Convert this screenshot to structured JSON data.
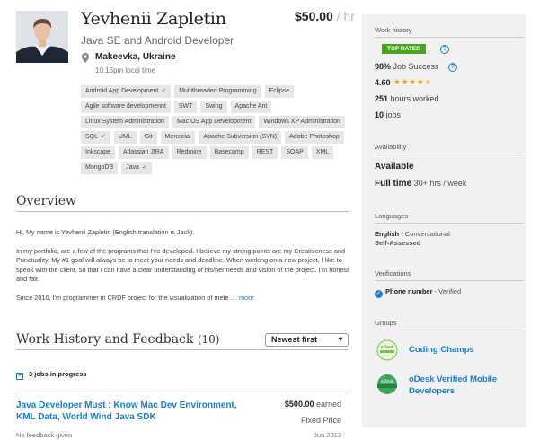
{
  "profile": {
    "name": "Yevhenii Zapletin",
    "title": "Java SE and Android Developer",
    "rate": "$50.00",
    "rate_unit": " / hr",
    "location": "Makeevka, Ukraine",
    "local_time": "10:15pm local time"
  },
  "skills": [
    {
      "label": "Android App Development",
      "verified": true
    },
    {
      "label": "Multithreaded Programming",
      "verified": false
    },
    {
      "label": "Eclipse",
      "verified": false
    },
    {
      "label": "Agile software developmennt",
      "verified": false
    },
    {
      "label": "SWT",
      "verified": false
    },
    {
      "label": "Swing",
      "verified": false
    },
    {
      "label": "Apache Ant",
      "verified": false
    },
    {
      "label": "Linux System Administration",
      "verified": false
    },
    {
      "label": "Mac OS App Development",
      "verified": false
    },
    {
      "label": "Windows XP Administration",
      "verified": false
    },
    {
      "label": "SQL",
      "verified": true
    },
    {
      "label": "UML",
      "verified": false
    },
    {
      "label": "Git",
      "verified": false
    },
    {
      "label": "Mercurial",
      "verified": false
    },
    {
      "label": "Apache Subversion (SVN)",
      "verified": false
    },
    {
      "label": "Adobe Photoshop",
      "verified": false
    },
    {
      "label": "Inkscape",
      "verified": false
    },
    {
      "label": "Atlassian JIRA",
      "verified": false
    },
    {
      "label": "Redmine",
      "verified": false
    },
    {
      "label": "Basecamp",
      "verified": false
    },
    {
      "label": "REST",
      "verified": false
    },
    {
      "label": "SOAP",
      "verified": false
    },
    {
      "label": "XML",
      "verified": false
    },
    {
      "label": "MongoDB",
      "verified": false
    },
    {
      "label": "Java",
      "verified": true
    }
  ],
  "overview": {
    "heading": "Overview",
    "paragraphs": [
      "Hi, My name is Yevhenii Zapletin (English translation is Jack).",
      "In my portfolio, are a few of the programs that I've developed. I believe my strong points are my Creativeness and Punctuality.  My #1 goal will always be to meet your needs and deadline. When working on a new project, I like to speak with the client, so that I can have a clear understanding of his/her needs and vision of the project.  I'm honest and fair.",
      "Since 2010, I'm programmer in CRDF project for the visualization of mete …"
    ],
    "more_link": "more"
  },
  "work_history": {
    "heading": "Work History and Feedback",
    "count": "(10)",
    "sort_selected": "Newest first",
    "in_progress": "3 jobs in progress",
    "jobs": [
      {
        "title": "Java Developer Must : Know Mac Dev Environment, KML Data, World Wind Java SDK",
        "amount": "$500.00",
        "amount_suffix": " earned",
        "type": "Fixed Price",
        "feedback": "No feedback given",
        "date": "Jun 2013"
      }
    ]
  },
  "sidebar": {
    "work_history_label": "Work history",
    "badge": "TOP RATED",
    "job_success_value": "98%",
    "job_success_label": " Job Success",
    "rating_value": "4.60",
    "rating_stars": 4.6,
    "hours_value": "251",
    "hours_label": " hours worked",
    "jobs_value": "10",
    "jobs_label": " jobs",
    "availability_label": "Availability",
    "availability_status": "Available",
    "availability_hours": "Full time",
    "availability_hours_sub": " 30+ hrs / week",
    "languages_label": "Languages",
    "language_name": "English",
    "language_level": " - Conversational",
    "language_note": "Self-Assessed",
    "verifications_label": "Verifications",
    "verification_item": "Phone number",
    "verification_status": " - Verified",
    "groups_label": "Groups",
    "groups": [
      {
        "name": "Coding Champs",
        "badge_text": "oDesk",
        "color": "#7cc242"
      },
      {
        "name": "oDesk Verified Mobile Developers",
        "badge_text": "oDesk",
        "color": "#3aa55b"
      }
    ]
  },
  "colors": {
    "link": "#1b7fc4",
    "top_rated": "#45a81c",
    "stars": "#f5a623",
    "sidebar_bg": "#f1f1f1"
  }
}
